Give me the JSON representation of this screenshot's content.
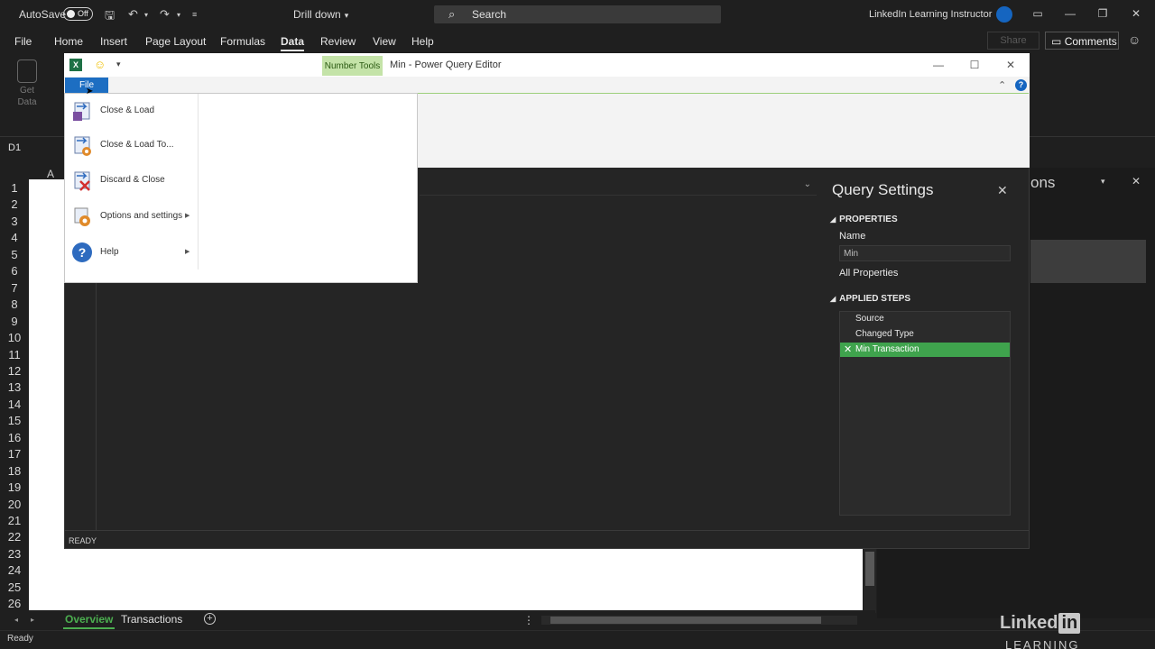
{
  "excel": {
    "autosave_label": "AutoSave",
    "autosave_state": "Off",
    "doc_title": "Drill down",
    "search_label": "Search",
    "user_name": "LinkedIn Learning Instructor",
    "tabs": [
      "File",
      "Home",
      "Insert",
      "Page Layout",
      "Formulas",
      "Data",
      "Review",
      "View",
      "Help"
    ],
    "active_tab": "Data",
    "share_label": "Share",
    "comments_label": "Comments",
    "get_data_label": "Get Data",
    "name_box": "D1",
    "column_a": "A",
    "rows": [
      "1",
      "2",
      "3",
      "4",
      "5",
      "6",
      "7",
      "8",
      "9",
      "10",
      "11",
      "12",
      "13",
      "14",
      "15",
      "16",
      "17",
      "18",
      "19",
      "20",
      "21",
      "22",
      "23",
      "24",
      "25",
      "26"
    ],
    "right_pane_title": "ons",
    "sheets": [
      "Overview",
      "Transactions"
    ],
    "active_sheet": "Overview",
    "status": "Ready",
    "watermark_linked": "Linked",
    "watermark_in": "in",
    "watermark_learning": "LEARNING"
  },
  "pq": {
    "context_tab": "Number Tools",
    "title": "Min - Power Query Editor",
    "file_tab": "File",
    "status": "READY",
    "file_menu": [
      {
        "label": "Close & Load",
        "icon": "close-load-icon",
        "submenu": false
      },
      {
        "label": "Close & Load To...",
        "icon": "close-load-to-icon",
        "submenu": false
      },
      {
        "label": "Discard & Close",
        "icon": "discard-close-icon",
        "submenu": false
      },
      {
        "label": "Options and settings",
        "icon": "options-gear-icon",
        "submenu": true
      },
      {
        "label": "Help",
        "icon": "help-icon",
        "submenu": true
      }
    ],
    "query_settings": {
      "title": "Query Settings",
      "properties_header": "PROPERTIES",
      "name_label": "Name",
      "name_value": "Min",
      "all_properties": "All Properties",
      "applied_steps_header": "APPLIED STEPS",
      "steps": [
        "Source",
        "Changed Type",
        "Min  Transaction"
      ],
      "selected_step": 2
    }
  },
  "colors": {
    "excel_green": "#4caf50",
    "step_selected": "#3fa34d",
    "file_tab_blue": "#1d6ec2",
    "number_tools_bg": "#c4e3a8"
  }
}
